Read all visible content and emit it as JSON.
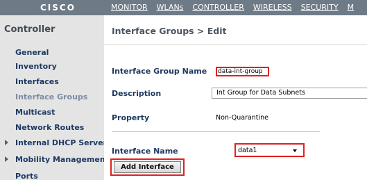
{
  "brand": {
    "logo_text": "CISCO"
  },
  "nav": {
    "items": [
      {
        "label": "MONITOR"
      },
      {
        "label": "WLANs"
      },
      {
        "label": "CONTROLLER"
      },
      {
        "label": "WIRELESS"
      },
      {
        "label": "SECURITY"
      },
      {
        "label": "M"
      }
    ]
  },
  "sidebar": {
    "title": "Controller",
    "items": [
      {
        "label": "General"
      },
      {
        "label": "Inventory"
      },
      {
        "label": "Interfaces"
      },
      {
        "label": "Interface Groups",
        "active": true
      },
      {
        "label": "Multicast"
      },
      {
        "label": "Network Routes"
      },
      {
        "label": "Internal DHCP Server",
        "expandable": true
      },
      {
        "label": "Mobility Management",
        "expandable": true
      },
      {
        "label": "Ports"
      }
    ]
  },
  "main": {
    "page_title": "Interface Groups > Edit",
    "fields": {
      "group_name_label": "Interface Group Name",
      "group_name_value": "data-int-group",
      "description_label": "Description",
      "description_value": "Int Group for Data Subnets",
      "property_label": "Property",
      "property_value": "Non-Quarantine",
      "interface_name_label": "Interface Name",
      "interface_name_selected": "data1"
    },
    "add_button_label": "Add Interface"
  },
  "colors": {
    "topbar": "#6e7b87",
    "sidebar_bg": "#e4e4e4",
    "link_dark_blue": "#1d3a62",
    "highlight_red": "#e02020"
  }
}
